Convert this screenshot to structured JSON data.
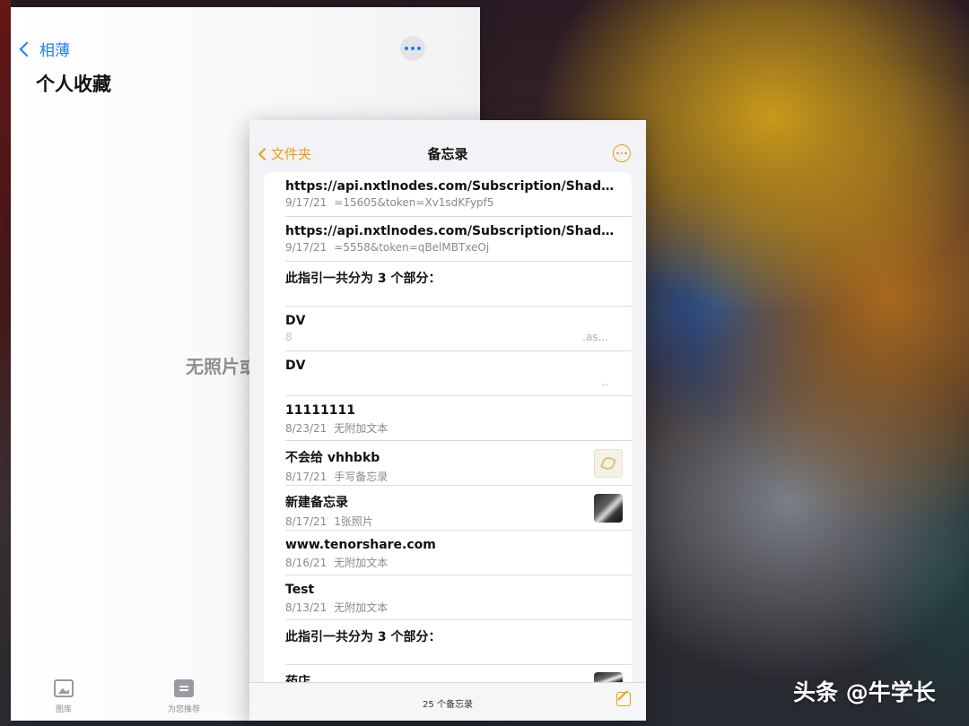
{
  "photos": {
    "back_label": "相薄",
    "title": "个人收藏",
    "empty_text": "无照片或",
    "tabs": [
      {
        "label": "图库",
        "icon": "photo-library-icon"
      },
      {
        "label": "为您推荐",
        "icon": "for-you-icon"
      }
    ]
  },
  "notes": {
    "back_label": "文件夹",
    "title": "备忘录",
    "more_icon": "ellipsis-circle-icon",
    "items": [
      {
        "title": "https://api.nxtlnodes.com/Subscription/ShadowRocket...",
        "date": "9/17/21",
        "detail": "=15605&token=Xv1sdKFypf5"
      },
      {
        "title": "https://api.nxtlnodes.com/Subscription/ShadowRocket...",
        "date": "9/17/21",
        "detail": "=5558&token=qBelMBTxeOj"
      },
      {
        "title": "此指引一共分为 3 个部分：",
        "date": "",
        "detail": ""
      },
      {
        "title": "DV",
        "date": "8",
        "detail": ".as..."
      },
      {
        "title": "DV",
        "date": "",
        "detail": ".."
      },
      {
        "title": "11111111",
        "date": "8/23/21",
        "detail": "无附加文本"
      },
      {
        "title": "不会给 vhhbkb",
        "date": "8/17/21",
        "detail": "手写备忘录"
      },
      {
        "title": "新建备忘录",
        "date": "8/17/21",
        "detail": "1张照片"
      },
      {
        "title": "www.tenorshare.com",
        "date": "8/16/21",
        "detail": "无附加文本"
      },
      {
        "title": "Test",
        "date": "8/13/21",
        "detail": "无附加文本"
      },
      {
        "title": "此指引一共分为 3 个部分：",
        "date": "",
        "detail": ""
      },
      {
        "title": "药店",
        "date": "",
        "detail": ""
      }
    ],
    "count_label": "25 个备忘录"
  },
  "watermark": "头条 @牛学长"
}
